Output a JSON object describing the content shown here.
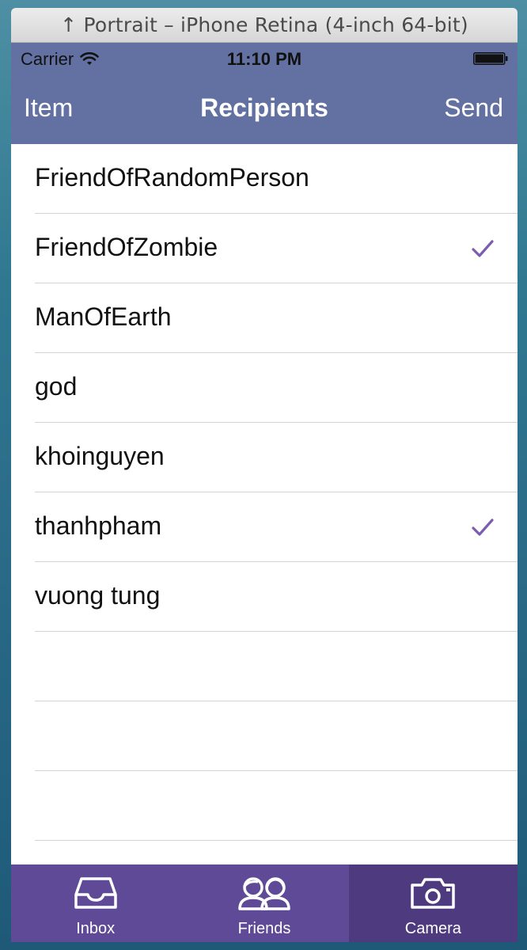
{
  "window": {
    "title": "↑ Portrait – iPhone Retina (4-inch 64-bit)"
  },
  "status_bar": {
    "carrier": "Carrier",
    "time": "11:10 PM"
  },
  "nav_bar": {
    "left_label": "Item",
    "title": "Recipients",
    "right_label": "Send",
    "color": "#6271a2"
  },
  "recipients": {
    "items": [
      {
        "label": "FriendOfRandomPerson",
        "checked": false
      },
      {
        "label": "FriendOfZombie",
        "checked": true
      },
      {
        "label": "ManOfEarth",
        "checked": false
      },
      {
        "label": "god",
        "checked": false
      },
      {
        "label": "khoinguyen",
        "checked": false
      },
      {
        "label": "thanhpham",
        "checked": true
      },
      {
        "label": "vuong tung",
        "checked": false
      }
    ],
    "check_color": "#7b5cb0"
  },
  "tab_bar": {
    "tabs": [
      {
        "label": "Inbox",
        "icon": "inbox-tray-icon",
        "selected": false
      },
      {
        "label": "Friends",
        "icon": "friends-icon",
        "selected": false
      },
      {
        "label": "Camera",
        "icon": "camera-icon",
        "selected": true
      }
    ],
    "color": "#5e4a96"
  }
}
